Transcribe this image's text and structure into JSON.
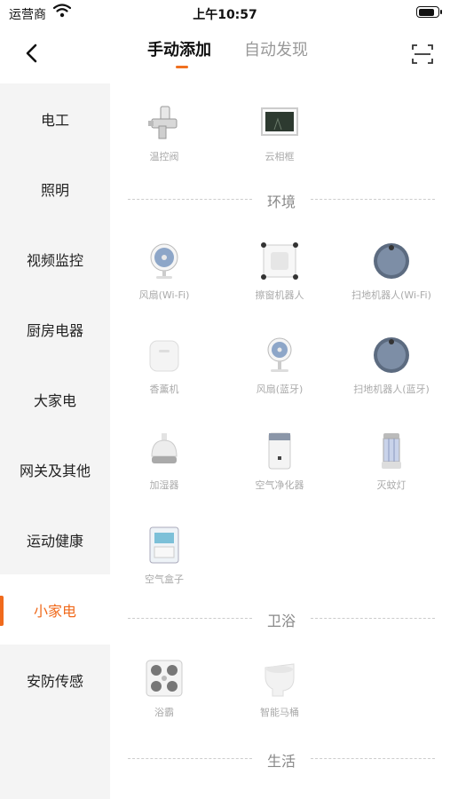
{
  "status_bar": {
    "carrier": "运营商",
    "time": "上午10:57",
    "battery_level": 0.85
  },
  "nav": {
    "tabs": [
      {
        "label": "手动添加",
        "active": true
      },
      {
        "label": "自动发现",
        "active": false
      }
    ]
  },
  "sidebar": {
    "items": [
      {
        "label": "电工",
        "active": false
      },
      {
        "label": "照明",
        "active": false
      },
      {
        "label": "视频监控",
        "active": false
      },
      {
        "label": "厨房电器",
        "active": false
      },
      {
        "label": "大家电",
        "active": false
      },
      {
        "label": "网关及其他",
        "active": false
      },
      {
        "label": "运动健康",
        "active": false
      },
      {
        "label": "小家电",
        "active": true
      },
      {
        "label": "安防传感",
        "active": false
      }
    ]
  },
  "top_items": [
    {
      "label": "温控阀",
      "icon": "valve-icon"
    },
    {
      "label": "云相框",
      "icon": "photo-frame-icon"
    }
  ],
  "sections": [
    {
      "title": "环境",
      "items": [
        {
          "label": "风扇(Wi-Fi)",
          "icon": "fan-icon"
        },
        {
          "label": "擦窗机器人",
          "icon": "window-robot-icon"
        },
        {
          "label": "扫地机器人(Wi-Fi)",
          "icon": "robot-vacuum-icon"
        },
        {
          "label": "香薰机",
          "icon": "aroma-diffuser-icon"
        },
        {
          "label": "风扇(蓝牙)",
          "icon": "fan-icon"
        },
        {
          "label": "扫地机器人(蓝牙)",
          "icon": "robot-vacuum-icon"
        },
        {
          "label": "加湿器",
          "icon": "humidifier-icon"
        },
        {
          "label": "空气净化器",
          "icon": "air-purifier-icon"
        },
        {
          "label": "灭蚊灯",
          "icon": "mosquito-lamp-icon"
        },
        {
          "label": "空气盒子",
          "icon": "air-box-icon"
        }
      ]
    },
    {
      "title": "卫浴",
      "items": [
        {
          "label": "浴霸",
          "icon": "bath-heater-icon"
        },
        {
          "label": "智能马桶",
          "icon": "smart-toilet-icon"
        }
      ]
    },
    {
      "title": "生活",
      "items": []
    }
  ],
  "colors": {
    "accent": "#f06a1c",
    "sidebar_bg": "#f4f4f4",
    "label_gray": "#aaaaaa"
  }
}
